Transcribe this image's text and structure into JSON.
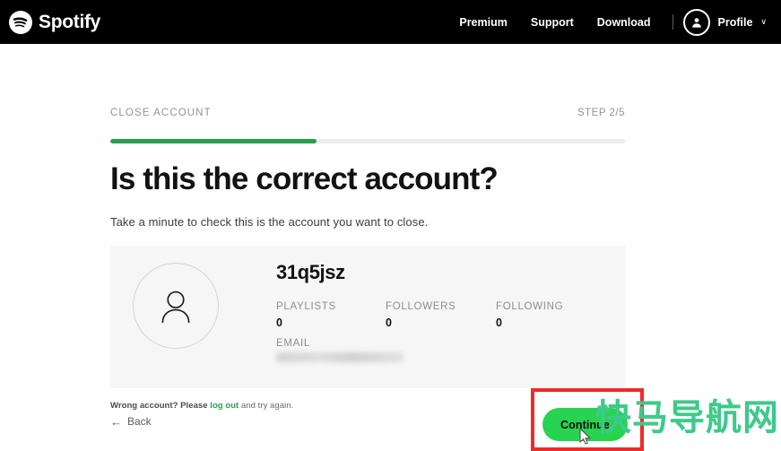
{
  "header": {
    "brand": "Spotify",
    "brand_icon": "spotify-logo-icon",
    "nav": [
      {
        "label": "Premium"
      },
      {
        "label": "Support"
      },
      {
        "label": "Download"
      }
    ],
    "profile": {
      "label": "Profile",
      "avatar_icon": "user-avatar-icon",
      "caret_icon": "chevron-down-icon",
      "caret_glyph": "∨"
    }
  },
  "flow": {
    "step_title": "CLOSE ACCOUNT",
    "step_count": "STEP 2/5",
    "progress_percent": 40,
    "progress_color": "#2a9e4e",
    "track_color": "#eceded"
  },
  "main": {
    "headline": "Is this the correct account?",
    "subline": "Take a minute to check this is the account you want to close."
  },
  "account": {
    "avatar_icon": "person-outline-icon",
    "username": "31q5jsz",
    "stats": [
      {
        "label": "PLAYLISTS",
        "value": "0"
      },
      {
        "label": "FOLLOWERS",
        "value": "0"
      },
      {
        "label": "FOLLOWING",
        "value": "0"
      }
    ],
    "email_label": "EMAIL",
    "email_value": ""
  },
  "footer": {
    "wrong_account_prefix": "Wrong account? Please ",
    "logout_link": "log out",
    "wrong_account_suffix": " and try again.",
    "back_label": "Back",
    "back_arrow_glyph": "←",
    "continue_label": "Continue",
    "continue_color": "#27d351",
    "highlight_color": "#ef2a2a"
  },
  "overlay": {
    "watermark_text": "快马导航网",
    "watermark_color": "#3fc98b",
    "cursor_icon": "mouse-pointer-icon"
  }
}
